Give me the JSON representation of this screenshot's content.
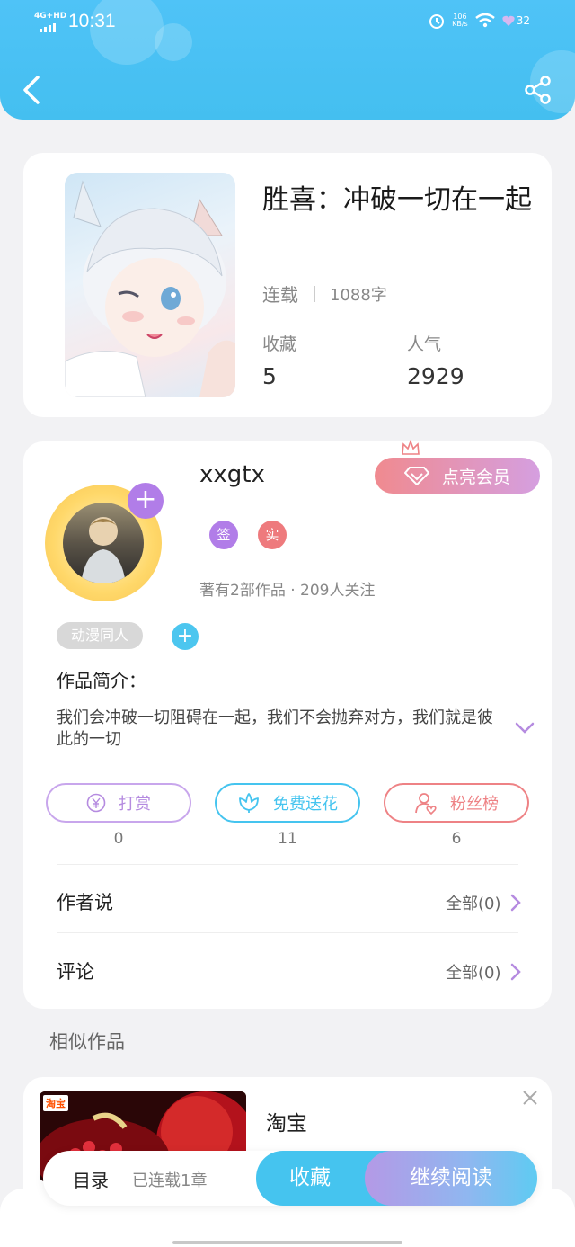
{
  "status_bar": {
    "network": "4G+HD",
    "time": "10:31",
    "speed_value": "106",
    "speed_unit": "KB/s",
    "battery": "32"
  },
  "book": {
    "title": "胜喜：冲破一切在一起",
    "status": "连载",
    "word_count": "1088字",
    "collect_label": "收藏",
    "collect_value": "5",
    "popularity_label": "人气",
    "popularity_value": "2929"
  },
  "author": {
    "name": "xxgtx",
    "vip_label": "点亮会员",
    "badge_sign": "签",
    "badge_real": "实",
    "stats": "著有2部作品 · 209人关注",
    "tag": "动漫同人"
  },
  "intro": {
    "title": "作品简介：",
    "text": "我们会冲破一切阻碍在一起，我们不会抛弃对方，我们就是彼此的一切"
  },
  "actions": [
    {
      "label": "打赏",
      "count": "0",
      "color": "#b58be0"
    },
    {
      "label": "免费送花",
      "count": "11",
      "color": "#45c4ef"
    },
    {
      "label": "粉丝榜",
      "count": "6",
      "color": "#ee8285"
    }
  ],
  "rows": {
    "author_says": "作者说",
    "author_says_link": "全部(0)",
    "comments": "评论",
    "comments_link": "全部(0)"
  },
  "similar_title": "相似作品",
  "ad": {
    "image_tag": "淘宝",
    "title": "淘宝"
  },
  "bottom_bar": {
    "toc_label": "目录",
    "toc_count": "已连载1章",
    "collect": "收藏",
    "read": "继续阅读"
  },
  "colors": {
    "header": "#4fc3f7",
    "purple": "#b17de8",
    "pink": "#ee8285",
    "cyan": "#45c4ef"
  }
}
